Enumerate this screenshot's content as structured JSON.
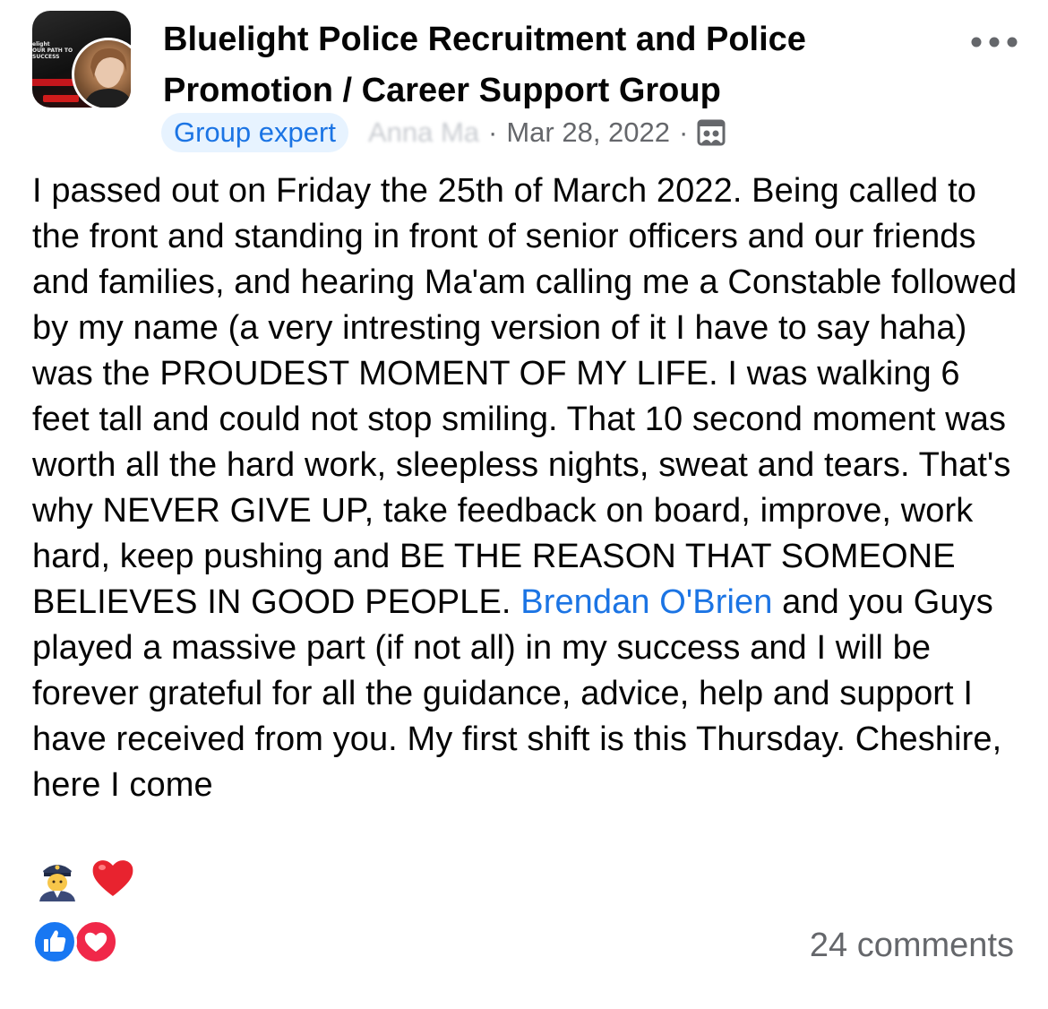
{
  "group": {
    "name": "Bluelight Police Recruitment and Police Promotion / Career Support Group",
    "thumbnail_lines": [
      "elight",
      "OUR PATH TO",
      "SUCCESS"
    ]
  },
  "meta": {
    "badge": "Group expert",
    "author": "Anna Ma",
    "separator": "·",
    "date": "Mar 28, 2022",
    "privacy_icon": "group-privacy-icon"
  },
  "post": {
    "text_part1": "I passed out on Friday the 25th of March 2022. Being called to the front and standing in front of senior officers and our friends and families, and hearing Ma'am calling me a Constable followed by my name (a very intresting version of it I have to say haha) was the PROUDEST MOMENT OF MY LIFE. I was walking 6 feet tall and could not stop smiling. That 10 second moment was worth all the hard work, sleepless nights, sweat and tears. That's why NEVER GIVE UP, take feedback on board, improve, work hard, keep pushing and BE THE REASON THAT SOMEONE BELIEVES IN GOOD PEOPLE. ",
    "mention": "Brendan O'Brien",
    "text_part2": " and you Guys played a massive part (if not all) in my success and I will be forever grateful for all the guidance, advice, help and support I have received from you. My first shift is this Thursday. Cheshire, here I come",
    "emojis": [
      "police-officer-emoji",
      "red-heart-emoji"
    ]
  },
  "footer": {
    "reactions": [
      "like",
      "love"
    ],
    "comments": "24 comments"
  },
  "colors": {
    "link": "#1b74e4",
    "badge_bg": "#e7f3ff",
    "secondary_text": "#65676b",
    "like": "#1877f2",
    "love": "#f02849"
  }
}
